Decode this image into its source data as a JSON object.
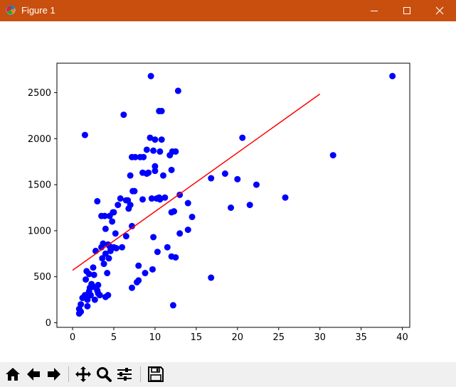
{
  "window": {
    "title": "Figure 1",
    "titlebar_color": "#c94f0f",
    "controls": [
      "minimize-icon",
      "maximize-icon",
      "close-icon"
    ]
  },
  "toolbar": {
    "buttons": [
      "home-icon",
      "back-arrow-icon",
      "forward-arrow-icon",
      "pan-icon",
      "zoom-icon",
      "configure-subplots-icon",
      "save-icon"
    ]
  },
  "chart_data": {
    "type": "scatter",
    "title": "",
    "xlabel": "",
    "ylabel": "",
    "xlim": [
      -1.9,
      40.9
    ],
    "ylim": [
      -50,
      2820
    ],
    "xticks": [
      0,
      5,
      10,
      15,
      20,
      25,
      30,
      35,
      40
    ],
    "yticks": [
      0,
      500,
      1000,
      1500,
      2000,
      2500
    ],
    "grid": false,
    "legend": "none",
    "series": [
      {
        "kind": "scatter",
        "color": "#0000ff",
        "points": [
          [
            0.8,
            100
          ],
          [
            0.8,
            150
          ],
          [
            1.0,
            120
          ],
          [
            1.0,
            200
          ],
          [
            1.2,
            270
          ],
          [
            1.5,
            2040
          ],
          [
            1.5,
            300
          ],
          [
            1.6,
            470
          ],
          [
            1.7,
            560
          ],
          [
            1.8,
            180
          ],
          [
            1.8,
            250
          ],
          [
            2.0,
            340
          ],
          [
            2.0,
            530
          ],
          [
            2.1,
            380
          ],
          [
            2.2,
            300
          ],
          [
            2.3,
            420
          ],
          [
            2.5,
            390
          ],
          [
            2.5,
            600
          ],
          [
            2.6,
            520
          ],
          [
            2.7,
            250
          ],
          [
            2.8,
            780
          ],
          [
            3.0,
            1320
          ],
          [
            3.0,
            350
          ],
          [
            3.1,
            410
          ],
          [
            3.1,
            320
          ],
          [
            3.3,
            300
          ],
          [
            3.5,
            1160
          ],
          [
            3.5,
            820
          ],
          [
            3.6,
            700
          ],
          [
            3.7,
            860
          ],
          [
            3.8,
            640
          ],
          [
            3.9,
            1160
          ],
          [
            4.0,
            1020
          ],
          [
            4.0,
            750
          ],
          [
            4.0,
            280
          ],
          [
            4.2,
            540
          ],
          [
            4.3,
            850
          ],
          [
            4.3,
            300
          ],
          [
            4.4,
            700
          ],
          [
            4.5,
            1160
          ],
          [
            4.5,
            830
          ],
          [
            4.6,
            780
          ],
          [
            4.8,
            1100
          ],
          [
            4.9,
            1200
          ],
          [
            5.0,
            820
          ],
          [
            5.0,
            1200
          ],
          [
            5.2,
            970
          ],
          [
            5.3,
            810
          ],
          [
            5.5,
            1280
          ],
          [
            5.8,
            1350
          ],
          [
            6.0,
            820
          ],
          [
            6.2,
            2260
          ],
          [
            6.5,
            1330
          ],
          [
            6.5,
            940
          ],
          [
            6.7,
            1330
          ],
          [
            6.8,
            1240
          ],
          [
            7.0,
            1280
          ],
          [
            7.0,
            1600
          ],
          [
            7.2,
            1050
          ],
          [
            7.2,
            380
          ],
          [
            7.2,
            1800
          ],
          [
            7.3,
            1430
          ],
          [
            7.5,
            1430
          ],
          [
            7.6,
            1800
          ],
          [
            7.8,
            440
          ],
          [
            8.0,
            460
          ],
          [
            8.0,
            620
          ],
          [
            8.2,
            1800
          ],
          [
            8.5,
            1340
          ],
          [
            8.5,
            1630
          ],
          [
            8.6,
            1800
          ],
          [
            8.8,
            540
          ],
          [
            9.0,
            1880
          ],
          [
            9.0,
            1620
          ],
          [
            9.2,
            1630
          ],
          [
            9.4,
            2010
          ],
          [
            9.5,
            2680
          ],
          [
            9.6,
            1350
          ],
          [
            9.7,
            580
          ],
          [
            9.8,
            930
          ],
          [
            9.8,
            1870
          ],
          [
            10.0,
            1700
          ],
          [
            10.0,
            1650
          ],
          [
            10.0,
            1990
          ],
          [
            10.2,
            1350
          ],
          [
            10.3,
            770
          ],
          [
            10.5,
            2300
          ],
          [
            10.5,
            1360
          ],
          [
            10.6,
            1860
          ],
          [
            10.6,
            1340
          ],
          [
            10.8,
            2300
          ],
          [
            10.8,
            1990
          ],
          [
            11.0,
            1600
          ],
          [
            11.2,
            1360
          ],
          [
            11.5,
            820
          ],
          [
            11.8,
            1820
          ],
          [
            12.0,
            1660
          ],
          [
            12.0,
            1200
          ],
          [
            12.0,
            720
          ],
          [
            12.1,
            1860
          ],
          [
            12.2,
            190
          ],
          [
            12.3,
            1210
          ],
          [
            12.5,
            1860
          ],
          [
            12.5,
            710
          ],
          [
            12.8,
            2520
          ],
          [
            13.0,
            970
          ],
          [
            13.0,
            1390
          ],
          [
            14.0,
            1010
          ],
          [
            14.0,
            1300
          ],
          [
            14.5,
            1150
          ],
          [
            16.8,
            1570
          ],
          [
            16.8,
            490
          ],
          [
            18.5,
            1620
          ],
          [
            19.2,
            1250
          ],
          [
            20.0,
            1560
          ],
          [
            20.6,
            2010
          ],
          [
            21.5,
            1280
          ],
          [
            22.3,
            1500
          ],
          [
            25.8,
            1360
          ],
          [
            31.6,
            1820
          ],
          [
            38.8,
            2680
          ]
        ]
      },
      {
        "kind": "line",
        "color": "#ff0000",
        "x": [
          0,
          30
        ],
        "y": [
          570,
          2485
        ]
      }
    ]
  }
}
